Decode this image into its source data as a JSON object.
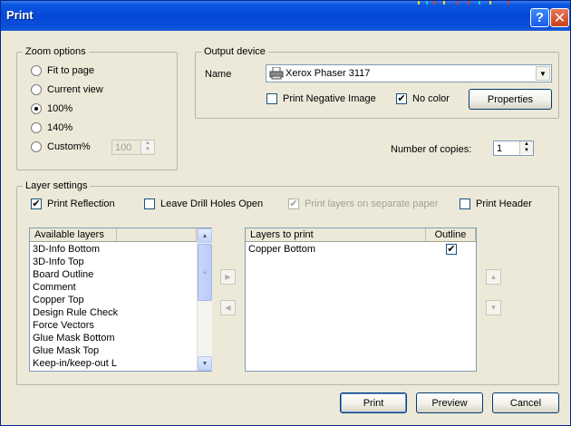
{
  "window": {
    "title": "Print"
  },
  "titlebar": {
    "help_glyph": "?",
    "close_glyph": "✕"
  },
  "zoom": {
    "legend": "Zoom options",
    "options": [
      {
        "label": "Fit to page",
        "selected": false
      },
      {
        "label": "Current view",
        "selected": false
      },
      {
        "label": "100%",
        "selected": true
      },
      {
        "label": "140%",
        "selected": false
      },
      {
        "label": "Custom%",
        "selected": false
      }
    ],
    "custom_value": "100"
  },
  "output": {
    "legend": "Output device",
    "name_label": "Name",
    "printer": "Xerox Phaser 3117",
    "print_negative_label": "Print Negative Image",
    "print_negative_checked": false,
    "no_color_label": "No color",
    "no_color_checked": true,
    "properties_label": "Properties"
  },
  "copies": {
    "label": "Number of copies:",
    "value": "1"
  },
  "layers": {
    "legend": "Layer settings",
    "print_reflection_label": "Print Reflection",
    "print_reflection_checked": true,
    "leave_drill_label": "Leave Drill Holes Open",
    "leave_drill_checked": false,
    "separate_paper_label": "Print layers on separate paper",
    "separate_paper_checked": true,
    "print_header_label": "Print Header",
    "print_header_checked": false,
    "available_header": "Available layers",
    "available": [
      "3D-Info Bottom",
      "3D-Info Top",
      "Board Outline",
      "Comment",
      "Copper Top",
      "Design Rule Check",
      "Force Vectors",
      "Glue Mask Bottom",
      "Glue Mask Top",
      "Keep-in/keep-out L"
    ],
    "to_print_header": "Layers to print",
    "outline_header": "Outline",
    "to_print": [
      {
        "name": "Copper Bottom",
        "outline": true
      }
    ]
  },
  "buttons": {
    "print": "Print",
    "preview": "Preview",
    "cancel": "Cancel"
  },
  "icons": {
    "check": "✔",
    "arrow_right": "▶",
    "arrow_left": "◀",
    "arrow_up": "▲",
    "arrow_down": "▼"
  },
  "colors": {
    "titlebar": "#0648d8",
    "dialog": "#ece9d8",
    "close": "#c8401a"
  }
}
